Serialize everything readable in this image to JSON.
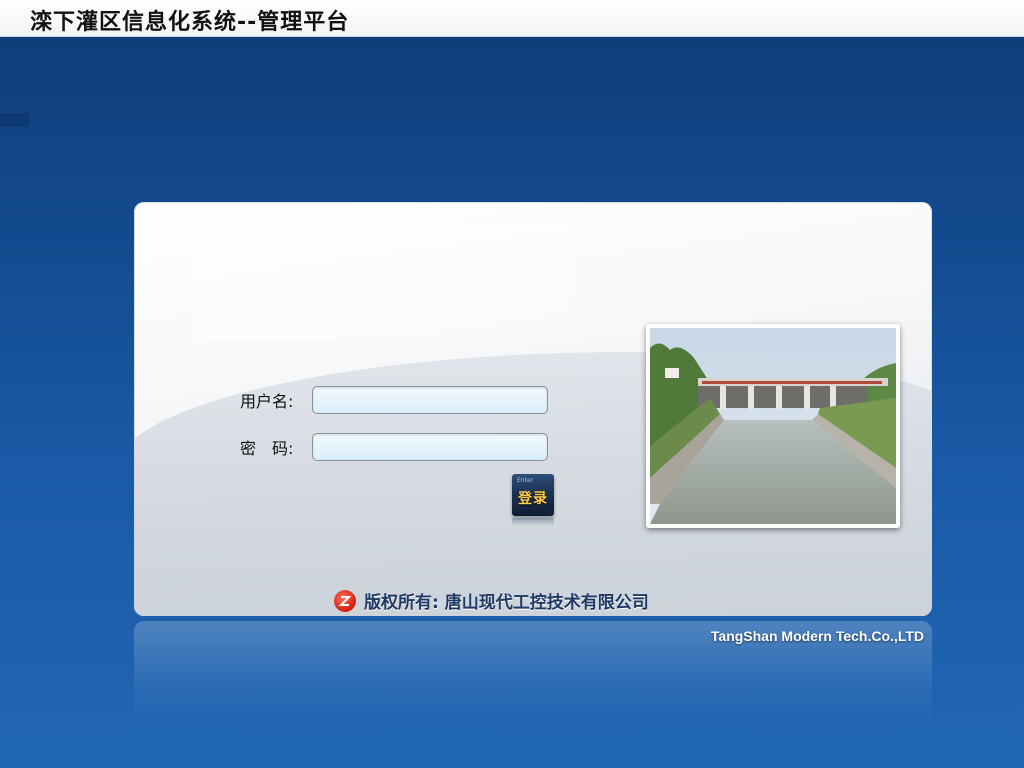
{
  "window": {
    "title": "滦下灌区信息化系统--管理平台"
  },
  "login": {
    "username_label": "用户名:",
    "password_label": "密　码:",
    "username_value": "",
    "password_value": "",
    "button_small_text": "Enter",
    "button_label": "登录"
  },
  "footer": {
    "copyright": "版权所有: 唐山现代工控技术有限公司",
    "company_en": "TangShan Modern Tech.Co.,LTD"
  },
  "colors": {
    "background": "#1a5aa6",
    "panel": "#eef0f3",
    "input_fill": "#d9eef9",
    "copyright_text": "#1f3a66",
    "logo_red": "#d31f12",
    "button_text": "#ffce4a"
  },
  "icons": {
    "company_logo": "red-circle-logo-icon",
    "photo": "dam-canal-photo"
  }
}
